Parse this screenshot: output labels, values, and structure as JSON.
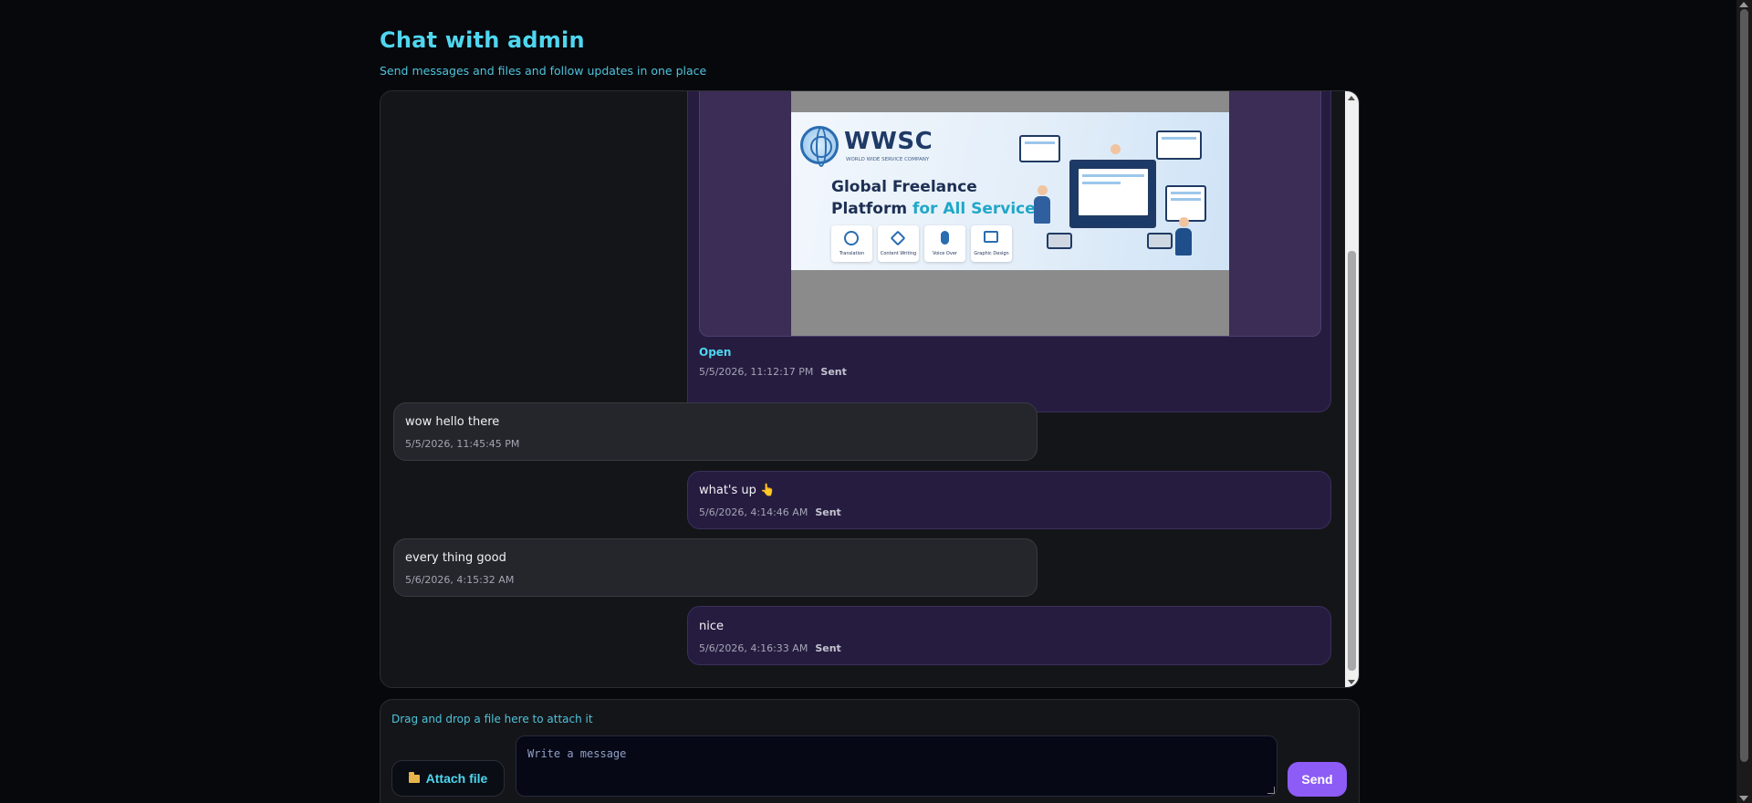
{
  "header": {
    "title": "Chat with admin",
    "subtitle": "Send messages and files and follow updates in one place"
  },
  "image_message": {
    "banner": {
      "logo": "WWSC",
      "logo_sub": "WORLD WIDE SERVICE COMPANY",
      "headline_1": "Global Freelance",
      "headline_2a": "Platform ",
      "headline_2b": "for All Services",
      "services": [
        "Translation",
        "Content Writing",
        "Voice Over",
        "Graphic Design"
      ]
    },
    "open_label": "Open",
    "timestamp": "5/5/2026, 11:12:17 PM",
    "status": "Sent"
  },
  "messages": [
    {
      "direction": "in",
      "text": "wow hello there",
      "timestamp": "5/5/2026, 11:45:45 PM",
      "status": ""
    },
    {
      "direction": "out",
      "text": "what's up 👆",
      "timestamp": "5/6/2026, 4:14:46 AM",
      "status": "Sent"
    },
    {
      "direction": "in",
      "text": "every thing good",
      "timestamp": "5/6/2026, 4:15:32 AM",
      "status": ""
    },
    {
      "direction": "out",
      "text": "nice",
      "timestamp": "5/6/2026, 4:16:33 AM",
      "status": "Sent"
    }
  ],
  "composer": {
    "drop_hint": "Drag and drop a file here to attach it",
    "attach_label": "Attach file",
    "placeholder": "Write a message",
    "send_label": "Send"
  },
  "colors": {
    "accent": "#4fd6ef",
    "send_button": "#8d5cf6",
    "outgoing_bubble": "#261c40",
    "incoming_bubble": "#25262b"
  }
}
